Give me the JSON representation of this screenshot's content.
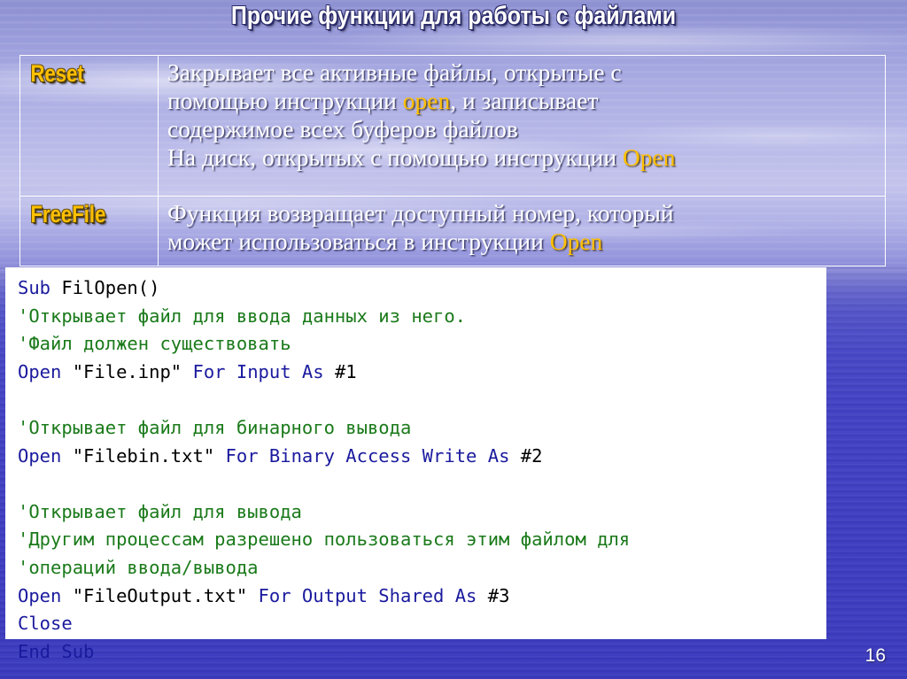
{
  "slide": {
    "title": "Прочие функции для работы с файлами",
    "page_number": "16"
  },
  "colors": {
    "accent_gold": "#FFC000",
    "title_white": "#FFFFFF",
    "code_keyword_blue": "#1A1A9E",
    "code_comment_green": "#1A7A1A",
    "code_background": "#FFFFFF",
    "background_top": "#B7B8E8",
    "background_bottom": "#3A3ABE"
  },
  "table": {
    "rows": [
      {
        "name": "Reset",
        "desc_parts": [
          {
            "text": "Закрывает все активные файлы, открытые с помощью инструкции ",
            "highlight": false
          },
          {
            "text": "open",
            "highlight": true
          },
          {
            "text": ", и записывает содержимое всех буферов файлов",
            "highlight": false
          },
          {
            "text": "\nНа диск, открытых с помощью инструкции ",
            "highlight": false
          },
          {
            "text": "Open",
            "highlight": true
          }
        ],
        "line1": "Закрывает все активные файлы, открытые с",
        "line2_pre": "помощью инструкции ",
        "line2_kw": "open",
        "line2_post": ", и записывает",
        "line3": "содержимое всех буферов файлов",
        "line4_pre": "На диск, открытых с помощью инструкции ",
        "line4_kw": "Open"
      },
      {
        "name": "FreeFile",
        "line1": "Функция возвращает доступный номер, который",
        "line2_pre": "может использоваться в инструкции ",
        "line2_kw": "Open"
      }
    ]
  },
  "code": {
    "lines": [
      [
        {
          "t": "Sub ",
          "c": "kw"
        },
        {
          "t": "FilOpen()",
          "c": "pl"
        }
      ],
      [
        {
          "t": "'Открывает файл для ввода данных из него.",
          "c": "cm"
        }
      ],
      [
        {
          "t": "'Файл должен существовать",
          "c": "cm"
        }
      ],
      [
        {
          "t": "Open ",
          "c": "kw"
        },
        {
          "t": "\"File.inp\"",
          "c": "str"
        },
        {
          "t": " ",
          "c": "pl"
        },
        {
          "t": "For Input As ",
          "c": "kw"
        },
        {
          "t": "#1",
          "c": "pl"
        }
      ],
      [
        {
          "t": "",
          "c": "pl"
        }
      ],
      [
        {
          "t": "'Открывает файл для бинарного вывода",
          "c": "cm"
        }
      ],
      [
        {
          "t": "Open ",
          "c": "kw"
        },
        {
          "t": "\"Filebin.txt\"",
          "c": "str"
        },
        {
          "t": " ",
          "c": "pl"
        },
        {
          "t": "For Binary Access Write As ",
          "c": "kw"
        },
        {
          "t": "#2",
          "c": "pl"
        }
      ],
      [
        {
          "t": "",
          "c": "pl"
        }
      ],
      [
        {
          "t": "'Открывает файл для вывода",
          "c": "cm"
        }
      ],
      [
        {
          "t": "'Другим процессам разрешено пользоваться этим файлом для",
          "c": "cm"
        }
      ],
      [
        {
          "t": "'операций ввода/вывода",
          "c": "cm"
        }
      ],
      [
        {
          "t": "Open ",
          "c": "kw"
        },
        {
          "t": "\"FileOutput.txt\"",
          "c": "str"
        },
        {
          "t": " ",
          "c": "pl"
        },
        {
          "t": "For Output Shared As ",
          "c": "kw"
        },
        {
          "t": "#3",
          "c": "pl"
        }
      ],
      [
        {
          "t": "Close",
          "c": "kw"
        }
      ],
      [
        {
          "t": "End Sub",
          "c": "kw"
        }
      ]
    ]
  }
}
